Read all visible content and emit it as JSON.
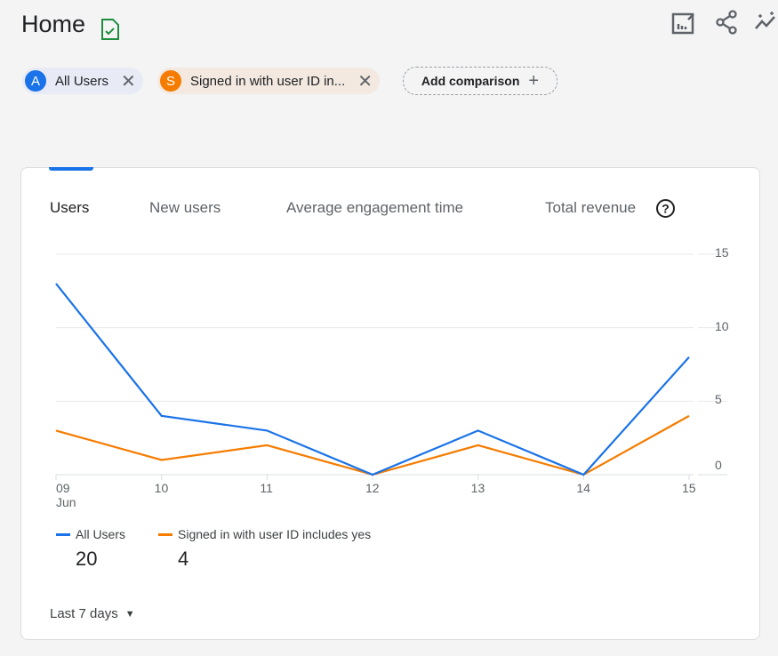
{
  "header": {
    "title": "Home",
    "icons": [
      "saved-report-icon",
      "customize-report-icon",
      "share-icon",
      "insights-icon"
    ]
  },
  "comparisons": [
    {
      "badge": "A",
      "label": "All Users",
      "color": "#1a73e8",
      "bg": "#e8eaf6"
    },
    {
      "badge": "S",
      "label": "Signed in with user ID in...",
      "color": "#f57c00",
      "bg": "#f3e9e1"
    }
  ],
  "add_comparison": "Add comparison",
  "tabs": [
    "Users",
    "New users",
    "Average engagement time",
    "Total revenue"
  ],
  "chart_data": {
    "type": "line",
    "categories": [
      "09",
      "10",
      "11",
      "12",
      "13",
      "14",
      "15"
    ],
    "x_sublabel": "Jun",
    "ylim": [
      0,
      15
    ],
    "yticks": [
      0,
      5,
      10,
      15
    ],
    "grid": true,
    "y_axis_side": "right",
    "legend_position": "bottom-left",
    "series": [
      {
        "name": "All Users",
        "color": "#1a73e8",
        "values": [
          13,
          4,
          3,
          0,
          3,
          0,
          8
        ],
        "total": "20"
      },
      {
        "name": "Signed in with user ID includes yes",
        "color": "#f57c00",
        "values": [
          3,
          1,
          2,
          0,
          2,
          0,
          4
        ],
        "total": "4"
      }
    ]
  },
  "date_range": "Last 7 days"
}
